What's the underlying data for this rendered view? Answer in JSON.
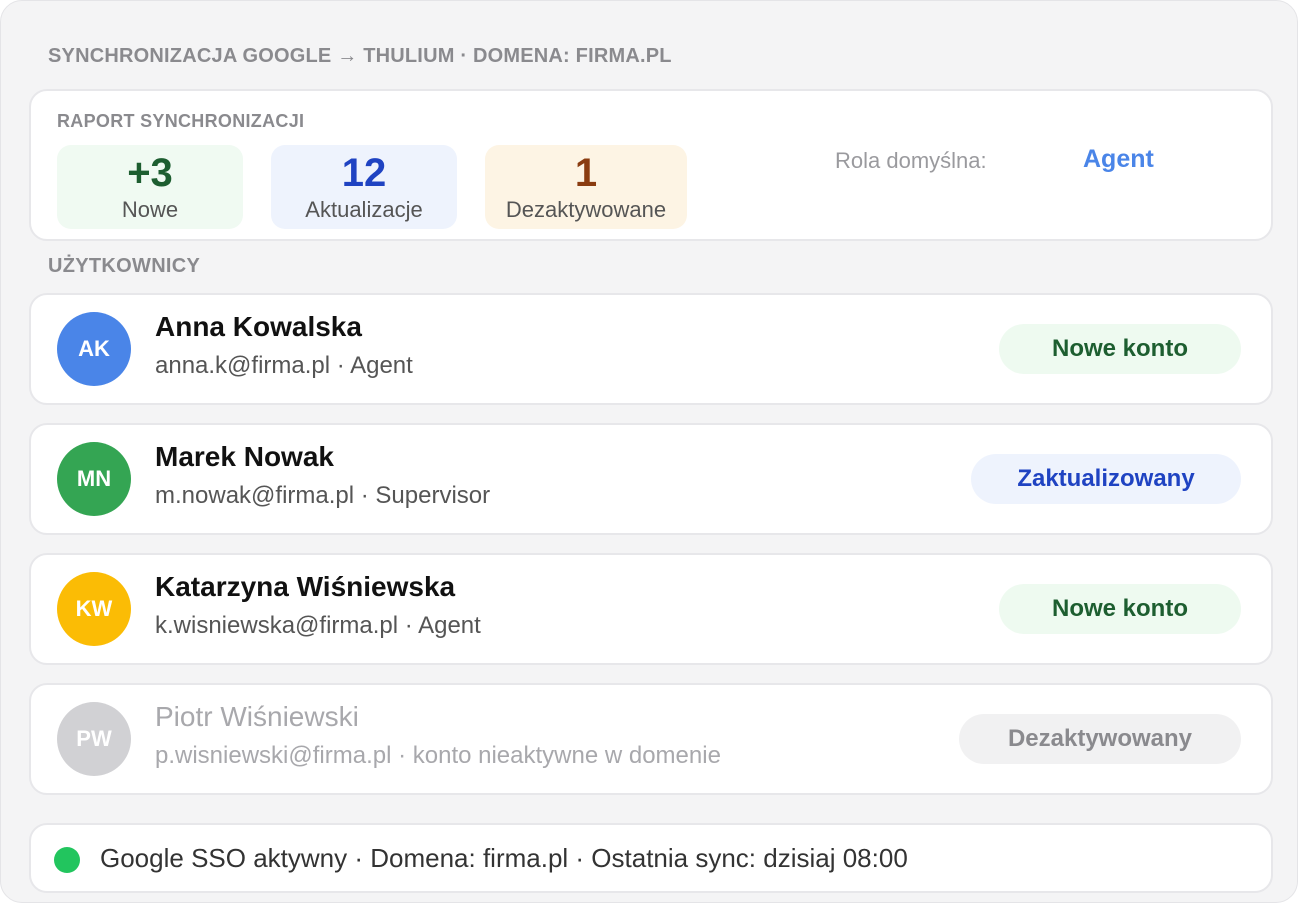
{
  "header": {
    "title": "SYNCHRONIZACJA GOOGLE → THULIUM · DOMENA: FIRMA.PL"
  },
  "report": {
    "label": "RAPORT SYNCHRONIZACJI",
    "stats": [
      {
        "value": "+3",
        "label": "Nowe"
      },
      {
        "value": "12",
        "label": "Aktualizacje"
      },
      {
        "value": "1",
        "label": "Dezaktywowane"
      }
    ],
    "default_role_label": "Rola domyślna:",
    "default_role_value": "Agent"
  },
  "users_section": {
    "label": "UŻYTKOWNICY"
  },
  "users": [
    {
      "initials": "AK",
      "name": "Anna Kowalska",
      "meta": "anna.k@firma.pl · Agent",
      "status": "Nowe konto",
      "avatar_color": "#4a85e8"
    },
    {
      "initials": "MN",
      "name": "Marek Nowak",
      "meta": "m.nowak@firma.pl · Supervisor",
      "status": "Zaktualizowany",
      "avatar_color": "#34a553"
    },
    {
      "initials": "KW",
      "name": "Katarzyna Wiśniewska",
      "meta": "k.wisniewska@firma.pl · Agent",
      "status": "Nowe konto",
      "avatar_color": "#fbbc05"
    },
    {
      "initials": "PW",
      "name": "Piotr Wiśniewski",
      "meta": "p.wisniewski@firma.pl · konto nieaktywne w domenie",
      "status": "Dezaktywowany",
      "avatar_color": "#d1d1d4"
    }
  ],
  "footer": {
    "status_color": "#22c55e",
    "text": "Google SSO aktywny · Domena: firma.pl · Ostatnia sync: dzisiaj 08:00"
  }
}
